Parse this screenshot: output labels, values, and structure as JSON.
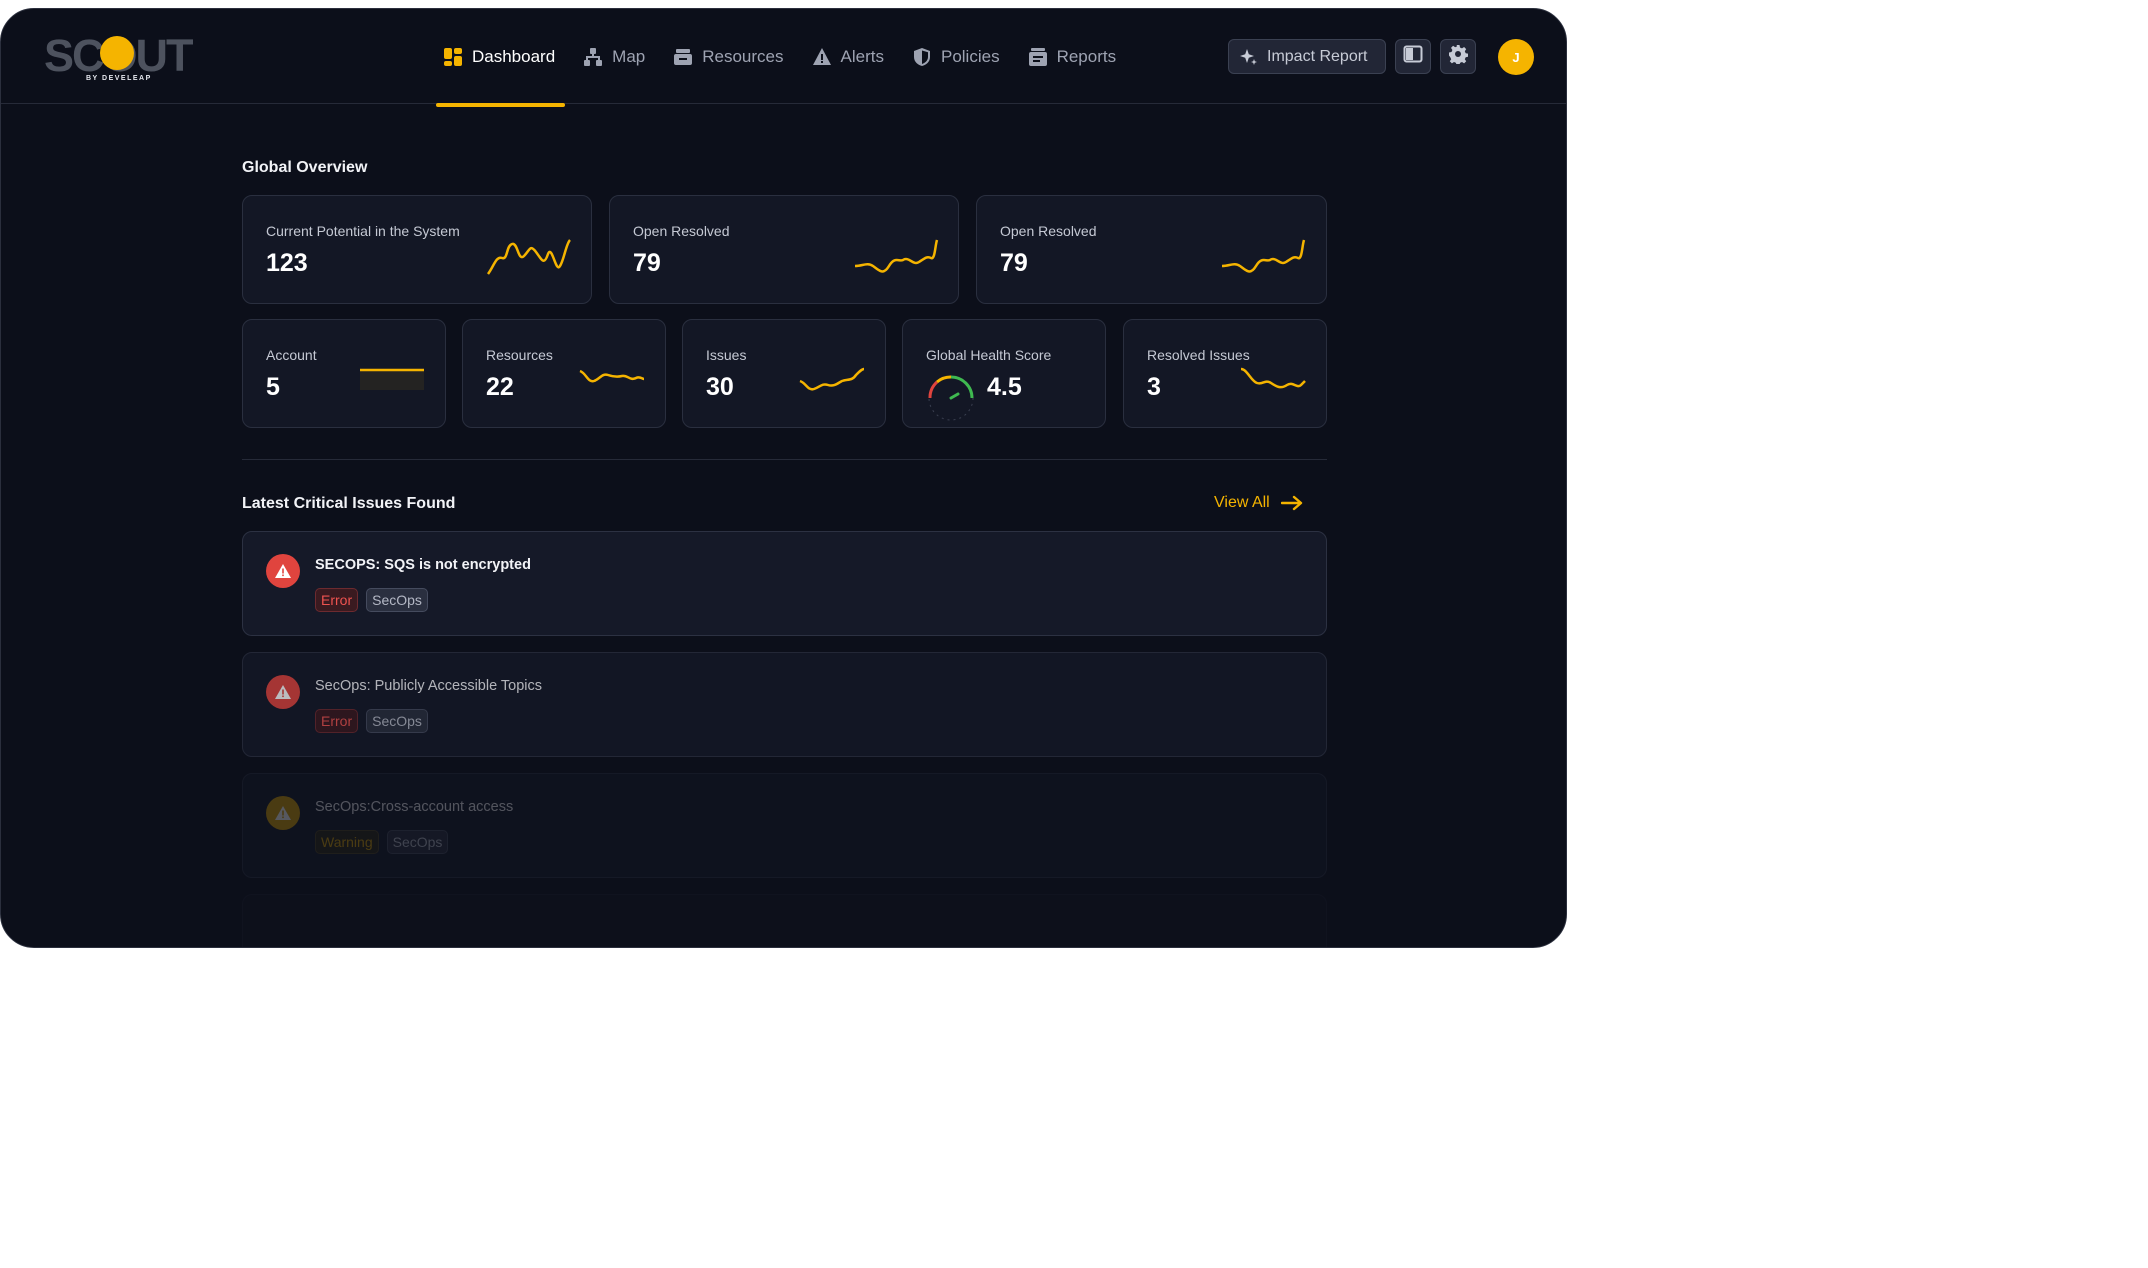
{
  "app": {
    "logo_text": "SCOUT",
    "logo_subtitle": "BY DEVELEAP"
  },
  "nav": {
    "items": [
      {
        "label": "Dashboard",
        "icon": "dashboard-icon",
        "active": true
      },
      {
        "label": "Map",
        "icon": "map-icon"
      },
      {
        "label": "Resources",
        "icon": "resources-icon"
      },
      {
        "label": "Alerts",
        "icon": "alert-triangle-icon"
      },
      {
        "label": "Policies",
        "icon": "shield-icon"
      },
      {
        "label": "Reports",
        "icon": "reports-icon"
      }
    ]
  },
  "header_actions": {
    "impact_report_label": "Impact Report",
    "avatar_initial": "J"
  },
  "overview": {
    "title": "Global Overview",
    "top_cards": [
      {
        "label": "Current Potential in the System",
        "value": "123"
      },
      {
        "label": "Open Resolved",
        "value": "79"
      },
      {
        "label": "Open Resolved",
        "value": "79"
      }
    ],
    "small_cards": [
      {
        "label": "Account",
        "value": "5"
      },
      {
        "label": "Resources",
        "value": "22"
      },
      {
        "label": "Issues",
        "value": "30"
      },
      {
        "label": "Global Health Score",
        "value": "4.5"
      },
      {
        "label": "Resolved Issues",
        "value": "3"
      }
    ]
  },
  "issues": {
    "title": "Latest Critical Issues Found",
    "view_all_label": "View All",
    "items": [
      {
        "title": "SECOPS: SQS is not encrypted",
        "severity": "Error",
        "category": "SecOps"
      },
      {
        "title": "SecOps: Publicly Accessible Topics",
        "severity": "Error",
        "category": "SecOps"
      },
      {
        "title": "SecOps:Cross-account access",
        "severity": "Warning",
        "category": "SecOps"
      }
    ]
  },
  "colors": {
    "accent": "#f5b400",
    "background": "#0c0f1a",
    "card": "#131725",
    "error": "#e0443e"
  }
}
